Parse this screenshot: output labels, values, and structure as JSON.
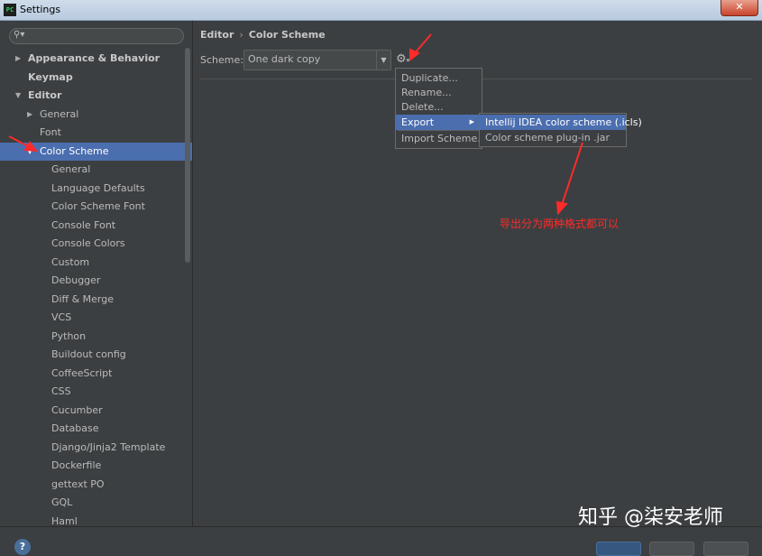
{
  "window": {
    "title": "Settings",
    "app_badge": "PC",
    "close_glyph": "✕"
  },
  "search": {
    "icon": "search-icon"
  },
  "tree": [
    {
      "label": "Appearance & Behavior",
      "bold": true,
      "expanded": false,
      "depth": 0
    },
    {
      "label": "Keymap",
      "bold": true,
      "depth": 0
    },
    {
      "label": "Editor",
      "bold": true,
      "expanded": true,
      "depth": 0
    },
    {
      "label": "General",
      "expanded": false,
      "depth": 1
    },
    {
      "label": "Font",
      "depth": 1
    },
    {
      "label": "Color Scheme",
      "expanded": true,
      "depth": 1,
      "selected": true
    },
    {
      "label": "General",
      "depth": 2
    },
    {
      "label": "Language Defaults",
      "depth": 2
    },
    {
      "label": "Color Scheme Font",
      "depth": 2
    },
    {
      "label": "Console Font",
      "depth": 2
    },
    {
      "label": "Console Colors",
      "depth": 2
    },
    {
      "label": "Custom",
      "depth": 2
    },
    {
      "label": "Debugger",
      "depth": 2
    },
    {
      "label": "Diff & Merge",
      "depth": 2
    },
    {
      "label": "VCS",
      "depth": 2
    },
    {
      "label": "Python",
      "depth": 2
    },
    {
      "label": "Buildout config",
      "depth": 2
    },
    {
      "label": "CoffeeScript",
      "depth": 2
    },
    {
      "label": "CSS",
      "depth": 2
    },
    {
      "label": "Cucumber",
      "depth": 2
    },
    {
      "label": "Database",
      "depth": 2
    },
    {
      "label": "Django/Jinja2 Template",
      "depth": 2
    },
    {
      "label": "Dockerfile",
      "depth": 2
    },
    {
      "label": "gettext PO",
      "depth": 2
    },
    {
      "label": "GQL",
      "depth": 2
    },
    {
      "label": "Haml",
      "depth": 2
    }
  ],
  "breadcrumb": {
    "parent": "Editor",
    "separator": "›",
    "current": "Color Scheme"
  },
  "scheme": {
    "label": "Scheme:",
    "value": "One dark copy"
  },
  "gear_menu": [
    {
      "label": "Duplicate..."
    },
    {
      "label": "Rename..."
    },
    {
      "label": "Delete..."
    },
    {
      "label": "Export",
      "active": true,
      "submenu": true
    },
    {
      "label": "Import Scheme..."
    }
  ],
  "export_submenu": [
    {
      "label": "Intellij IDEA color scheme (.icls)",
      "active": true
    },
    {
      "label": "Color scheme plug-in .jar"
    }
  ],
  "annotation": "导出分为两种格式都可以",
  "watermark": "知乎 @柒安老师",
  "footer": {
    "help_glyph": "?"
  },
  "colors": {
    "background": "#3c3f41",
    "selection": "#4b6eaf",
    "annotation": "#ff2a2a"
  }
}
